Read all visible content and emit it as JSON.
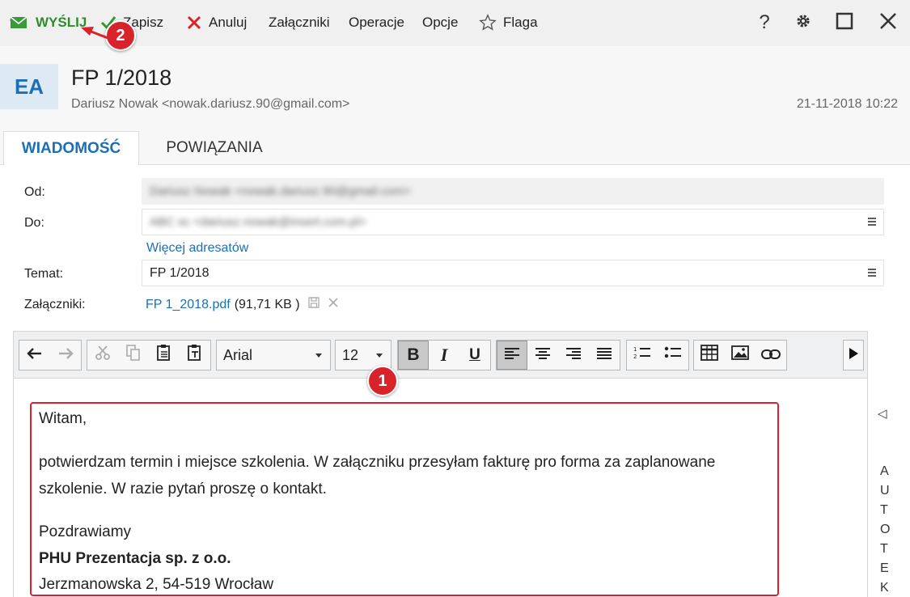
{
  "toolbar": {
    "send": "WYŚLIJ",
    "save": "Zapisz",
    "cancel": "Anuluj",
    "attachments": "Załączniki",
    "operations": "Operacje",
    "options": "Opcje",
    "flag": "Flaga"
  },
  "header": {
    "avatar": "EA",
    "subject": "FP 1/2018",
    "sender": "Dariusz Nowak <nowak.dariusz.90@gmail.com>",
    "date": "21-11-2018 10:22"
  },
  "tabs": [
    "WIADOMOŚĆ",
    "POWIĄZANIA"
  ],
  "form": {
    "from_label": "Od:",
    "from_value": "Dariusz Nowak <nowak.dariusz.90@gmail.com>",
    "to_label": "Do:",
    "to_value": "ABC sc <dariusz.nowak@insert.com.pl>",
    "more_recipients": "Więcej adresatów",
    "subject_label": "Temat:",
    "subject_value": "FP 1/2018",
    "attachments_label": "Załączniki:",
    "attachment_name": "FP 1_2018.pdf",
    "attachment_size": "(91,71 KB )"
  },
  "editor": {
    "font": "Arial",
    "size": "12"
  },
  "body": {
    "greeting": "Witam,",
    "line1": "potwierdzam termin i miejsce szkolenia. W załączniku przesyłam fakturę pro forma za zaplanowane",
    "line2": "szkolenie. W razie pytań proszę o kontakt.",
    "closing": "Pozdrawiamy",
    "company": "PHU Prezentacja sp. z o.o.",
    "address": "Jerzmanowska 2, 54-519 Wrocław"
  },
  "side_panel": {
    "letters": [
      "A",
      "U",
      "T",
      "O",
      "T",
      "E",
      "K"
    ]
  },
  "badges": {
    "one": "1",
    "two": "2"
  },
  "colors": {
    "accent": "#1d6fb5",
    "send_green": "#2e8b2e",
    "highlight_red": "#e01e2b"
  }
}
